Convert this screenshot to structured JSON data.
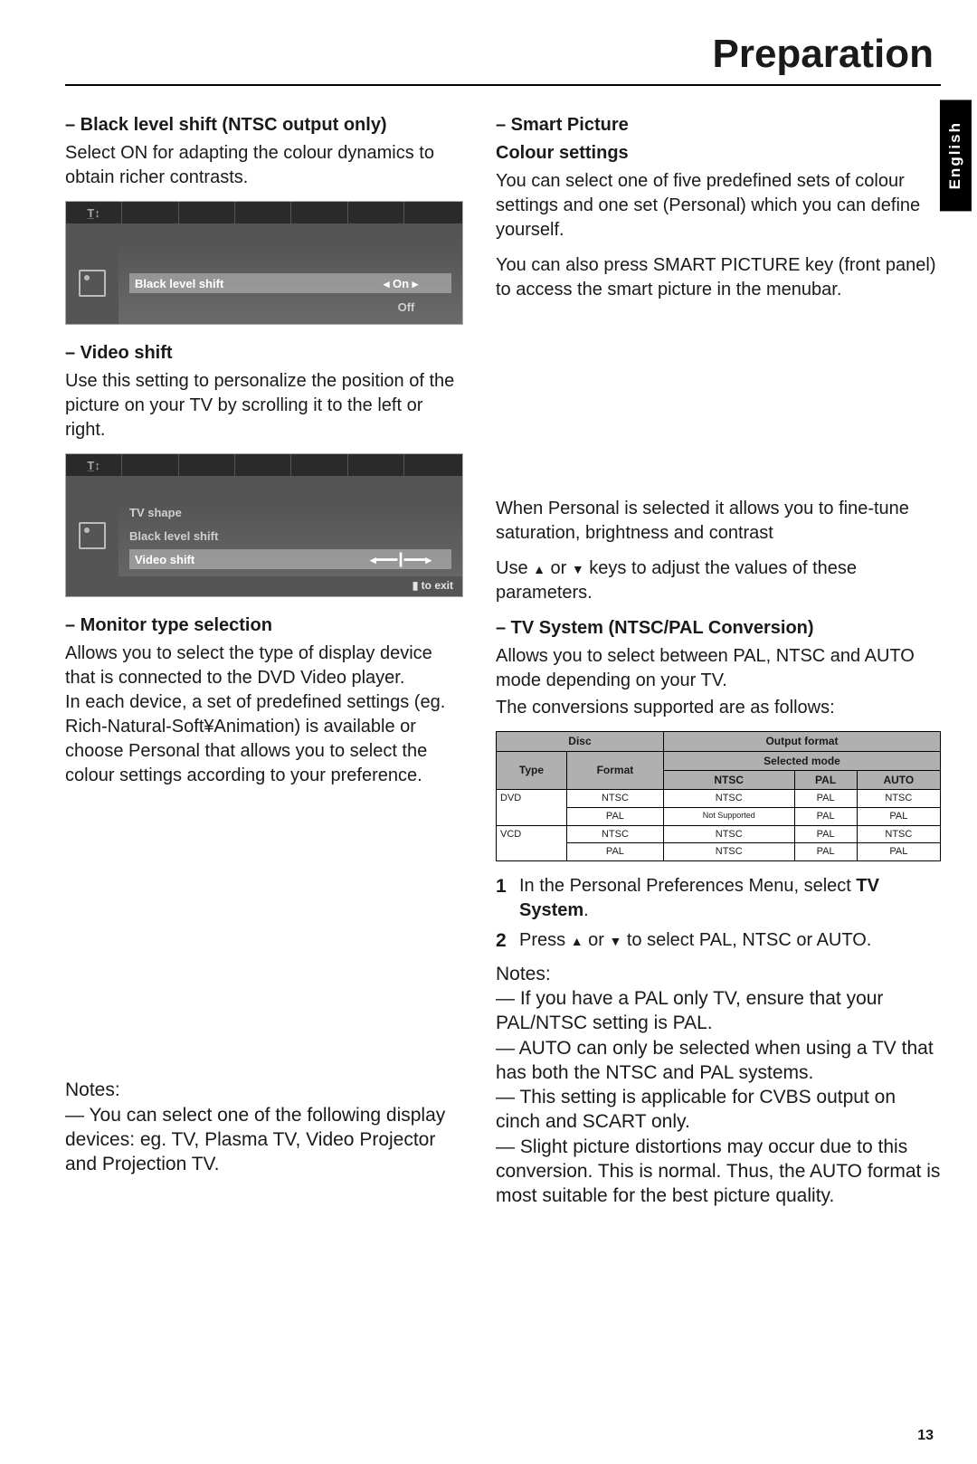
{
  "header": {
    "title": "Preparation"
  },
  "lang_tab": "English",
  "page_number": "13",
  "left": {
    "black_level": {
      "heading": "–   Black level shift (NTSC output only)",
      "body": "Select ON for adapting the colour dynamics to obtain richer contrasts."
    },
    "osd1": {
      "row_hl_key": "Black level shift",
      "row_hl_val_top": "◂ On ▸",
      "row_hl_val_bot": "Off"
    },
    "video_shift": {
      "heading": "–   Video shift",
      "body": "Use this setting to personalize the position of the picture on your TV by scrolling it to the left or right."
    },
    "osd2": {
      "row1": "TV shape",
      "row2": "Black level shift",
      "row_hl_key": "Video shift",
      "slider": "◂━━━┃━━━▸",
      "footer": "▮ to exit"
    },
    "monitor": {
      "heading": "–   Monitor type selection",
      "body": "Allows you to select the type of display device that is connected to the DVD Video player.\nIn each device, a set of predefined settings (eg. Rich-Natural-Soft¥Animation) is available or choose  Personal  that allows you to select the colour settings according to your preference."
    },
    "notes_left": {
      "label": "Notes:",
      "line1": "—   You can select one of the following display devices: eg. TV, Plasma TV, Video Projector and Projection TV."
    }
  },
  "right": {
    "smart": {
      "heading": "–   Smart Picture",
      "subheading": "Colour settings",
      "body1": "You can select one of five predefined sets of colour settings and one set (Personal) which you can define yourself.",
      "body2": "You can also press SMART PICTURE key (front panel) to access the smart picture in the menubar."
    },
    "personal": {
      "line1_a": "When ",
      "line1_b": "Personal",
      "line1_c": " is selected it allows you to fine-tune saturation, brightness and contrast",
      "line2_a": "Use ",
      "line2_b": " or ",
      "line2_c": " keys to adjust the values of these parameters."
    },
    "tvsys": {
      "heading": "–   TV System (NTSC/PAL Conversion)",
      "body1": "Allows you to select between PAL, NTSC and AUTO mode depending on your TV.",
      "body2": "The conversions supported are as follows:"
    },
    "conv": {
      "h_disc": "Disc",
      "h_out": "Output format",
      "h_type": "Type",
      "h_format": "Format",
      "h_sel": "Selected mode",
      "h_ntsc": "NTSC",
      "h_pal": "PAL",
      "h_auto": "AUTO",
      "rows": [
        {
          "type": "DVD",
          "fmt": "NTSC",
          "a": "NTSC",
          "b": "PAL",
          "c": "NTSC"
        },
        {
          "type": "",
          "fmt": "PAL",
          "a": "Not Supported",
          "b": "PAL",
          "c": "PAL",
          "small": true
        },
        {
          "type": "VCD",
          "fmt": "NTSC",
          "a": "NTSC",
          "b": "PAL",
          "c": "NTSC"
        },
        {
          "type": "",
          "fmt": "PAL",
          "a": "NTSC",
          "b": "PAL",
          "c": "PAL"
        }
      ]
    },
    "steps": {
      "s1_a": "In the Personal Preferences Menu, select ",
      "s1_b": "TV System",
      "s1_c": ".",
      "s2_a": "Press ",
      "s2_b": " or ",
      "s2_c": " to select PAL, NTSC or AUTO."
    },
    "notes_right": {
      "label": "Notes:",
      "l1": "—   If you have a PAL only TV, ensure that your PAL/NTSC setting is PAL.",
      "l2": "—   AUTO can only be selected when using a TV that has both the NTSC and PAL systems.",
      "l3": "—   This setting is applicable for CVBS output on cinch and SCART only.",
      "l4": "—   Slight picture distortions may occur due to this conversion. This is normal. Thus, the AUTO format is most suitable for the best picture quality."
    }
  }
}
